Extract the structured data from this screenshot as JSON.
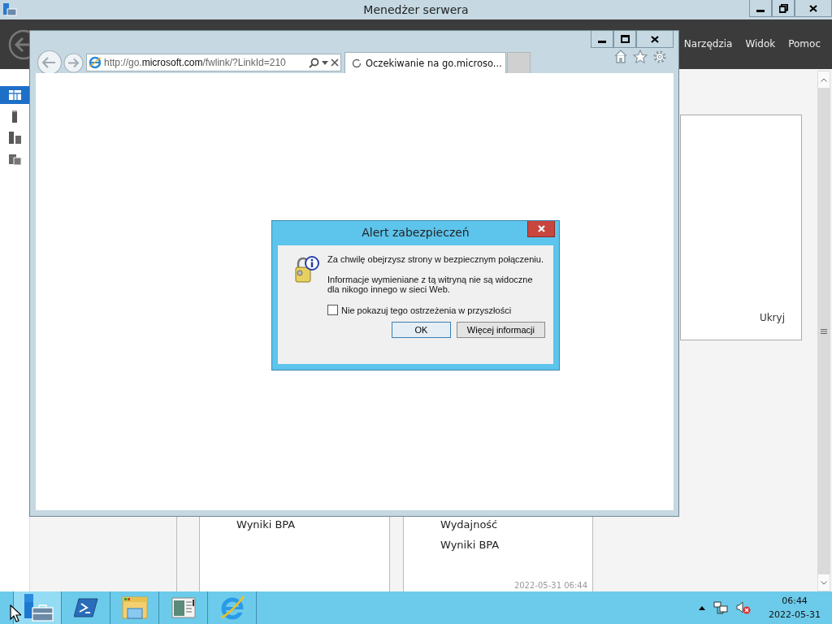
{
  "server_manager": {
    "title": "Menedżer serwera",
    "menu": [
      "Narzędzia",
      "Widok",
      "Pomoc"
    ],
    "nav_items": [
      {
        "kind": "dashboard",
        "selected": true
      },
      {
        "kind": "local",
        "selected": false
      },
      {
        "kind": "all",
        "selected": false
      },
      {
        "kind": "roles",
        "selected": false
      }
    ],
    "hide_label": "Ukryj",
    "tiles": [
      {
        "lines": [
          "Wyniki BPA"
        ]
      },
      {
        "lines": [
          "Wydajność",
          "Wyniki BPA"
        ],
        "timestamp": "2022-05-31 06:44"
      }
    ]
  },
  "browser": {
    "address": "http://go.**microsoft.com**/fwlink/?LinkId=210",
    "tab": {
      "title": "Oczekiwanie na go.microso...",
      "loading": true
    }
  },
  "dialog": {
    "title": "Alert zabezpieczeń",
    "message": "Za chwilę obejrzysz strony w bezpiecznym połączeniu.",
    "detail": "Informacje wymieniane z tą witryną nie są widoczne dla nikogo innego w sieci Web.",
    "checkbox": {
      "label": "Nie pokazuj tego ostrzeżenia w przyszłości",
      "checked": false
    },
    "buttons": [
      {
        "label": "OK",
        "default": true
      },
      {
        "label": "Więcej informacji",
        "default": false
      }
    ]
  },
  "taskbar": {
    "apps": [
      {
        "kind": "server-manager",
        "selected": true
      },
      {
        "kind": "powershell",
        "selected": false
      },
      {
        "kind": "explorer",
        "selected": false
      },
      {
        "kind": "console",
        "selected": false
      },
      {
        "kind": "ie",
        "selected": false
      }
    ],
    "time": "06:44",
    "date": "2022-05-31"
  }
}
